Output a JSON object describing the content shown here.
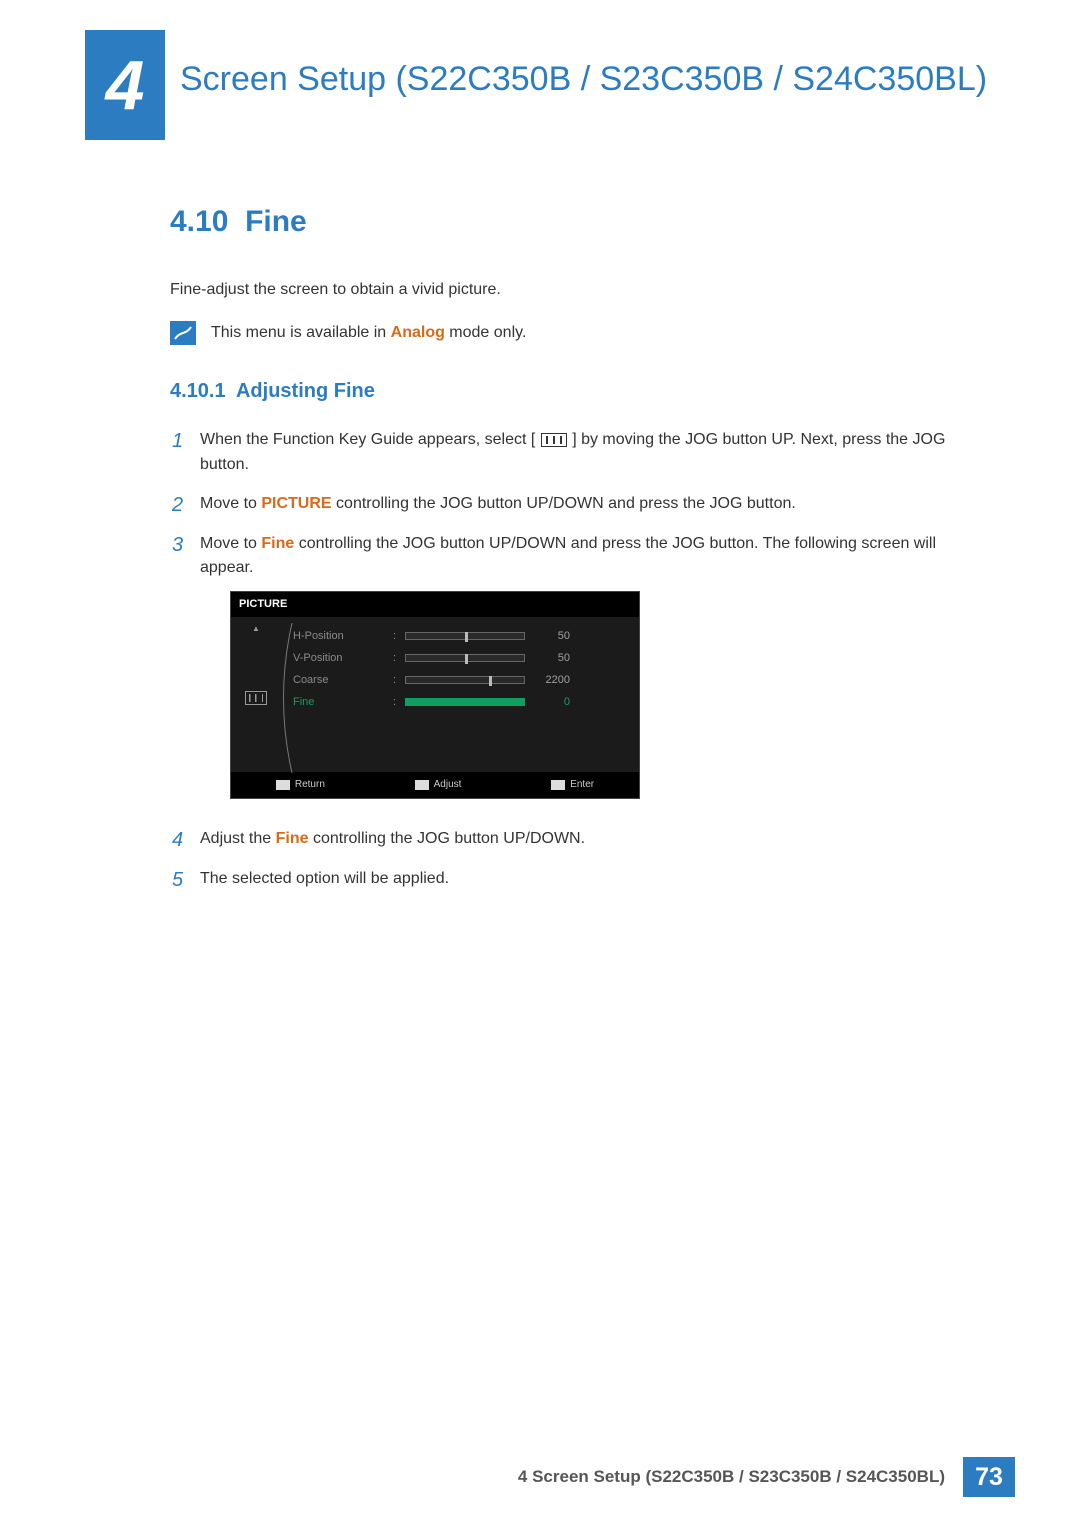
{
  "chapter_number": "4",
  "chapter_title": "Screen Setup (S22C350B / S23C350B / S24C350BL)",
  "section": {
    "number": "4.10",
    "title": "Fine"
  },
  "intro": "Fine-adjust the screen to obtain a vivid picture.",
  "note": {
    "prefix": "This menu is available in ",
    "highlight": "Analog",
    "suffix": " mode only."
  },
  "subsection": {
    "number": "4.10.1",
    "title": "Adjusting Fine"
  },
  "steps": {
    "s1": {
      "num": "1",
      "pre": "When the Function Key Guide appears, select ",
      "lb": "[ ",
      "rb": " ]",
      "post": " by moving the JOG button UP. Next, press the JOG button."
    },
    "s2": {
      "num": "2",
      "pre": "Move to ",
      "bold": "PICTURE",
      "post": " controlling the JOG button UP/DOWN and press the JOG button."
    },
    "s3": {
      "num": "3",
      "pre": "Move to ",
      "bold": "Fine",
      "post": " controlling the JOG button UP/DOWN and press the JOG button. The following screen will appear."
    },
    "s4": {
      "num": "4",
      "pre": "Adjust the ",
      "bold": "Fine",
      "post": " controlling the JOG button UP/DOWN."
    },
    "s5": {
      "num": "5",
      "text": "The selected option will be applied."
    }
  },
  "osd": {
    "title": "PICTURE",
    "rows": {
      "r0": {
        "label": "H-Position",
        "value": "50",
        "knob_pct": 50
      },
      "r1": {
        "label": "V-Position",
        "value": "50",
        "knob_pct": 50
      },
      "r2": {
        "label": "Coarse",
        "value": "2200",
        "knob_pct": 70
      },
      "r3": {
        "label": "Fine",
        "value": "0",
        "knob_pct": 0
      }
    },
    "footer": {
      "f0": "Return",
      "f1": "Adjust",
      "f2": "Enter"
    }
  },
  "footer": {
    "text": "4 Screen Setup (S22C350B / S23C350B / S24C350BL)",
    "page": "73"
  }
}
